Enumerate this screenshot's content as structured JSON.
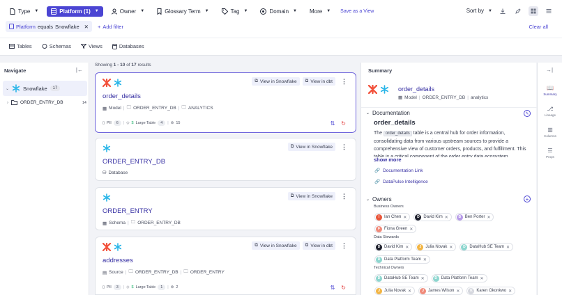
{
  "filters": [
    {
      "label": "Type",
      "icon": "file-icon",
      "active": false
    },
    {
      "label": "Platform (1)",
      "icon": "database-icon",
      "active": true
    },
    {
      "label": "Owner",
      "icon": "user-icon",
      "active": false
    },
    {
      "label": "Glossary Term",
      "icon": "bookmark-icon",
      "active": false
    },
    {
      "label": "Tag",
      "icon": "tag-icon",
      "active": false
    },
    {
      "label": "Domain",
      "icon": "globe-icon",
      "active": false
    },
    {
      "label": "More",
      "icon": "",
      "active": false
    }
  ],
  "save_as_view": "Save as a View",
  "sort_by": "Sort by",
  "active_filter": {
    "key": "Platform",
    "op": "equals",
    "value": "Snowflake"
  },
  "add_filter": "Add filter",
  "clear_all": "Clear all",
  "type_tabs": [
    "Tables",
    "Schemas",
    "Views",
    "Databases"
  ],
  "navigate": {
    "title": "Navigate",
    "root": {
      "label": "Snowflake",
      "count": "17"
    },
    "child": {
      "label": "ORDER_ENTRY_DB",
      "count": "14"
    }
  },
  "results": {
    "prefix": "Showing",
    "range": "1 - 10",
    "of": "of",
    "total": "17",
    "suffix": "results"
  },
  "cards": [
    {
      "title": "order_details",
      "type": "Model",
      "path": [
        "ORDER_ENTRY_DB",
        "ANALYTICS"
      ],
      "view_snowflake": "View in Snowflake",
      "view_dbt": "View in dbt",
      "pii": "PII",
      "pii_count": "6",
      "tag": "Large Table",
      "tag_count": "4",
      "lineage_count": "15"
    },
    {
      "title": "ORDER_ENTRY_DB",
      "type": "Database",
      "view_snowflake": "View in Snowflake"
    },
    {
      "title": "ORDER_ENTRY",
      "type": "Schema",
      "path": [
        "ORDER_ENTRY_DB"
      ],
      "view_snowflake": "View in Snowflake"
    },
    {
      "title": "addresses",
      "type": "Source",
      "path": [
        "ORDER_ENTRY_DB",
        "ORDER_ENTRY"
      ],
      "view_snowflake": "View in Snowflake",
      "view_dbt": "View in dbt",
      "pii": "PII",
      "pii_count": "3",
      "tag": "Large Table",
      "tag_count": "1",
      "lineage_count": "2"
    }
  ],
  "summary": {
    "title": "Summary",
    "entity_name": "order_details",
    "entity_type": "Model",
    "entity_path": [
      "ORDER_ENTRY_DB",
      "analytics"
    ],
    "documentation_label": "Documentation",
    "doc_heading": "order_details",
    "doc_pre": "The",
    "doc_code": "order_details",
    "doc_post": "table is a central hub for order information, consolidating data from various upstream sources to provide a comprehensive view of customer orders, products, and fulfillment. This table is a critical component of the order entry data ecosystem.",
    "show_more": "show more",
    "links": [
      "Documentation Link",
      "DataPulse Intelligence"
    ],
    "owners_label": "Owners",
    "owner_groups": [
      {
        "label": "Business Owners",
        "rows": [
          [
            {
              "name": "Ian Chen",
              "initial": "I",
              "color": "#e8553a"
            },
            {
              "name": "David Kim",
              "initial": "D",
              "color": "#1d1f2b"
            },
            {
              "name": "Ben Porter",
              "initial": "B",
              "color": "#b79be8"
            }
          ],
          [
            {
              "name": "Fiona Green",
              "initial": "F",
              "color": "#f08a7a"
            }
          ]
        ]
      },
      {
        "label": "Data Stewards",
        "rows": [
          [
            {
              "name": "David Kim",
              "initial": "D",
              "color": "#1d1f2b"
            },
            {
              "name": "Julia Novak",
              "initial": "J",
              "color": "#f2b544"
            },
            {
              "name": "DataHub SE Team",
              "initial": "D",
              "color": "#8ed6cf"
            }
          ],
          [
            {
              "name": "Data Platform Team",
              "initial": "D",
              "color": "#8ed6cf"
            }
          ]
        ]
      },
      {
        "label": "Technical Owners",
        "rows": [
          [
            {
              "name": "DataHub SE Team",
              "initial": "D",
              "color": "#8ed6cf"
            },
            {
              "name": "Data Platform Team",
              "initial": "D",
              "color": "#8ed6cf"
            }
          ],
          [
            {
              "name": "Julia Novak",
              "initial": "J",
              "color": "#f2b544"
            },
            {
              "name": "James Wilson",
              "initial": "J",
              "color": "#f08a7a"
            },
            {
              "name": "Karen Okonkwo",
              "initial": "K",
              "color": "#d5d7de"
            }
          ]
        ]
      }
    ]
  },
  "rail": [
    "Summary",
    "Lineage",
    "Columns",
    "Props"
  ],
  "colors": {
    "accent": "#4b45d3",
    "link": "#3730a3",
    "dbt": "#f2513b",
    "snowflake": "#29b5e8"
  }
}
